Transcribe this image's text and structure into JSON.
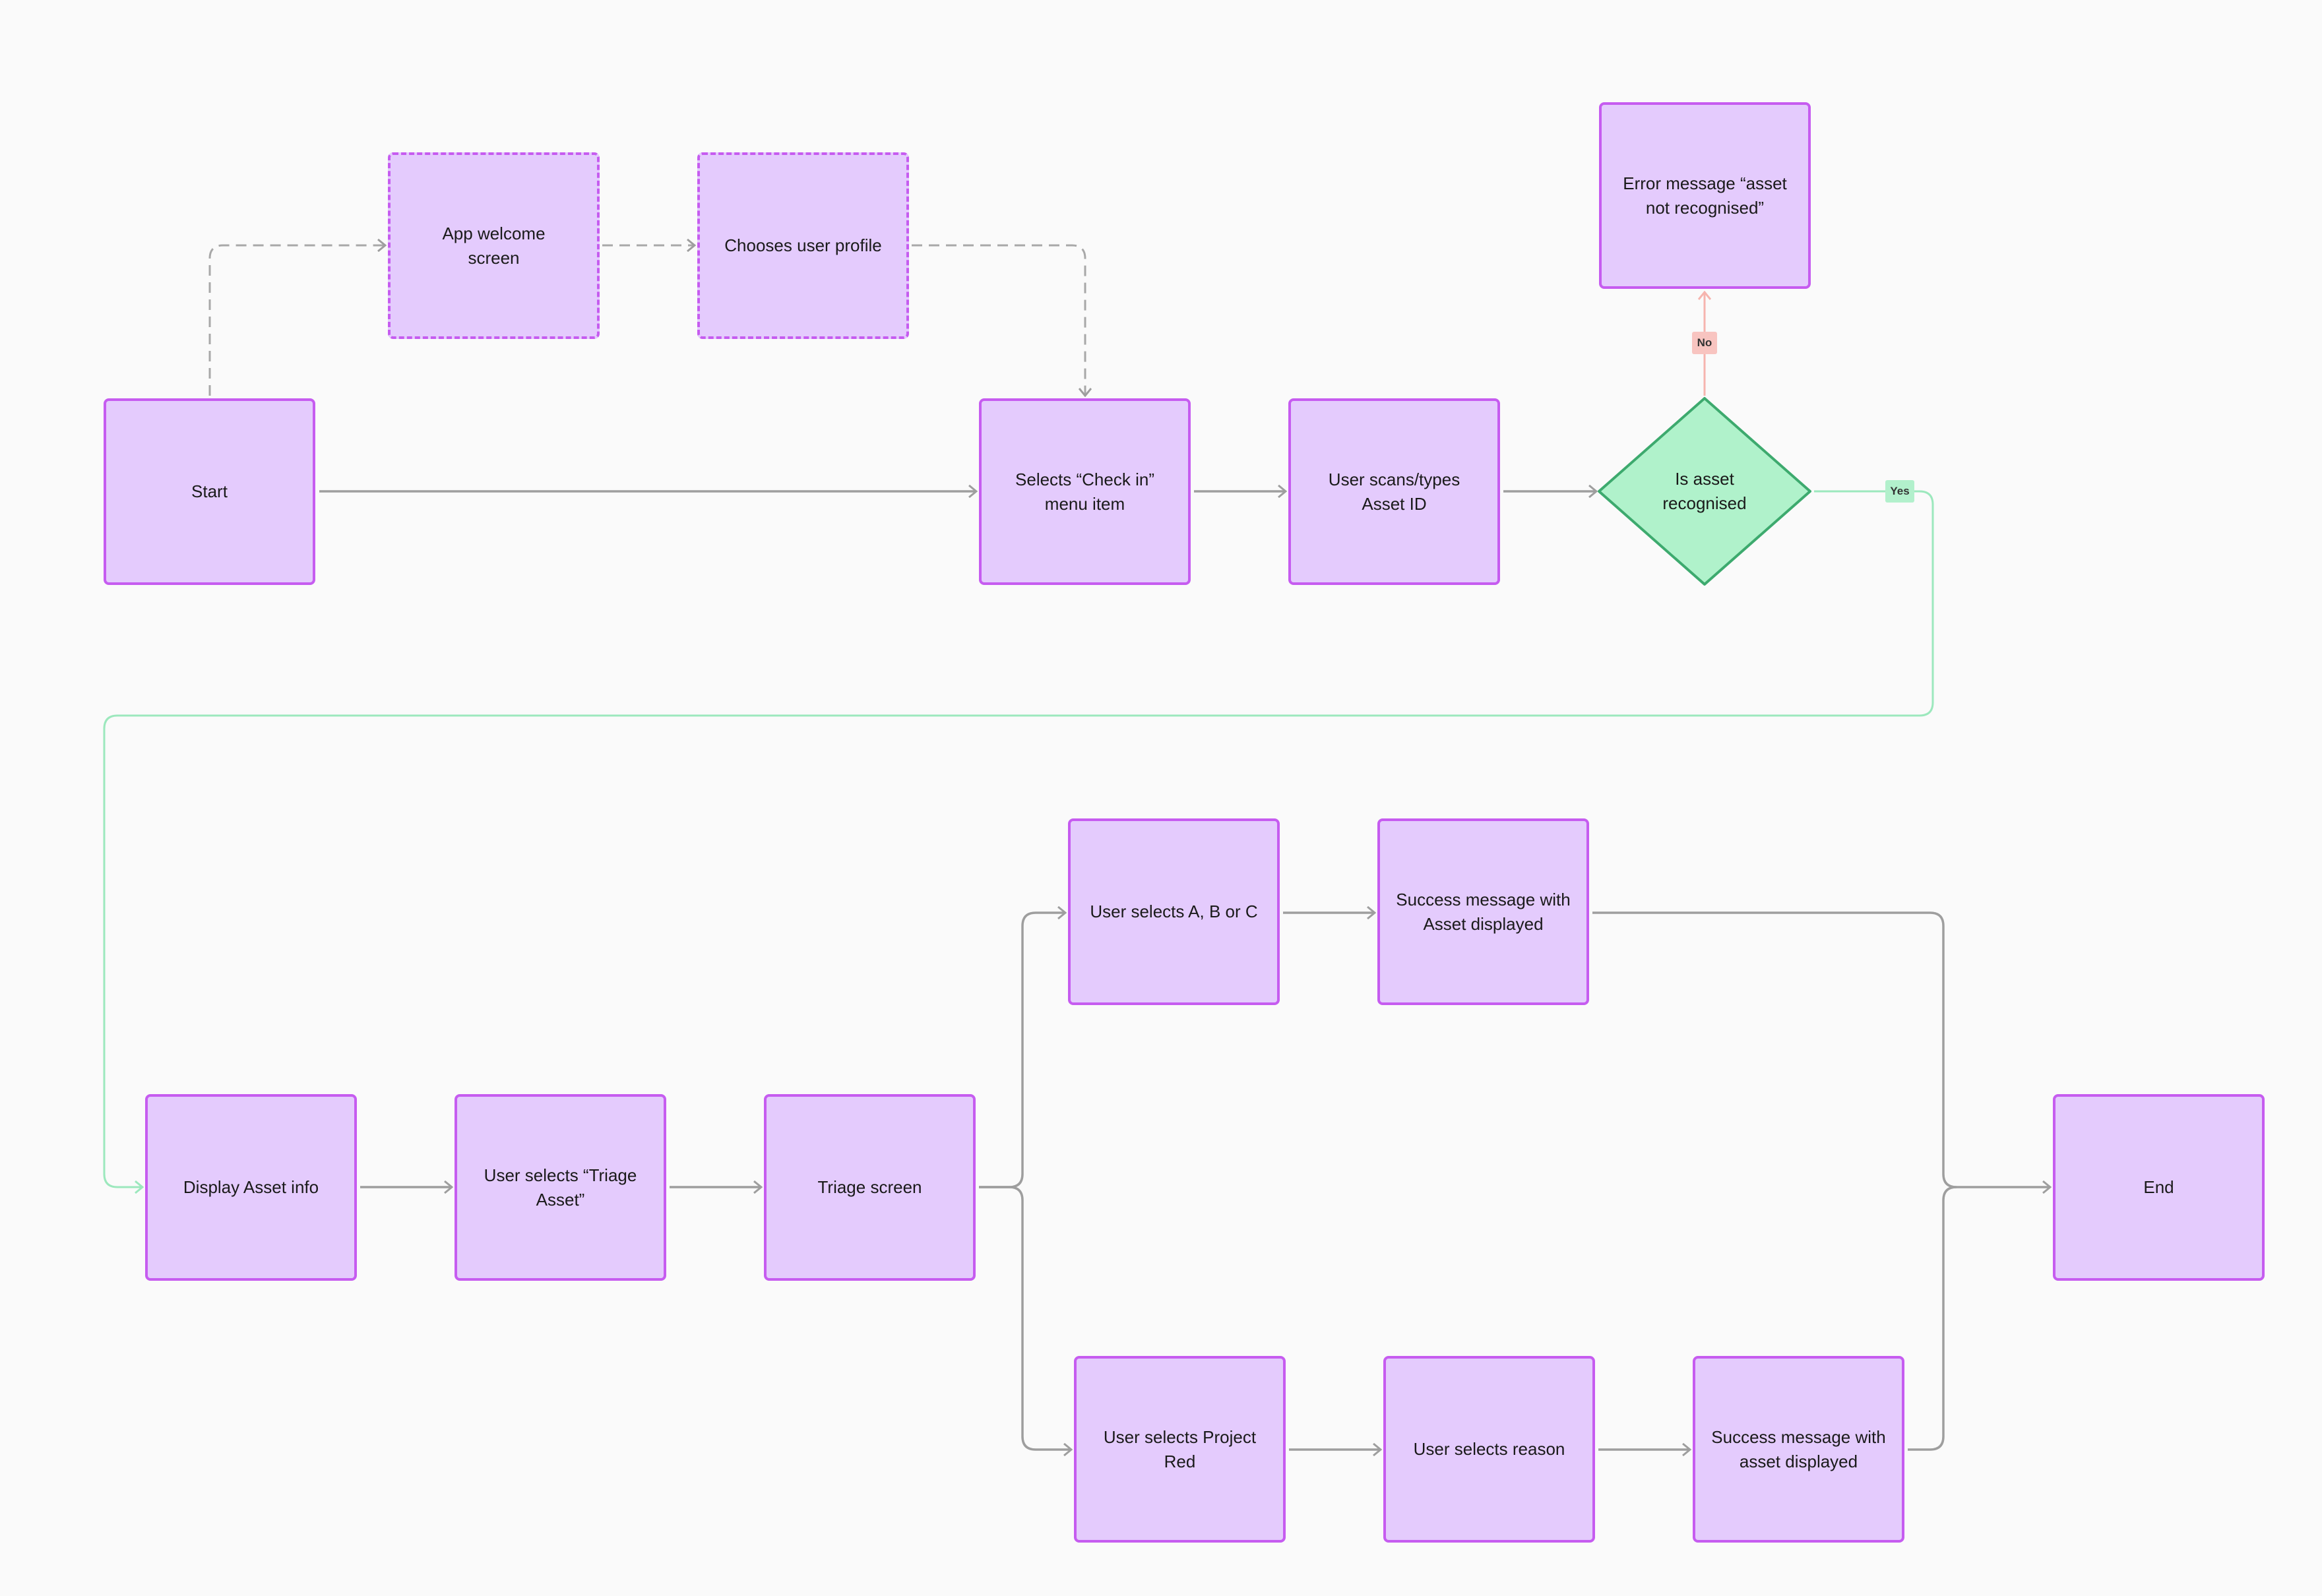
{
  "diagram": {
    "type": "flowchart",
    "nodes": {
      "start": "Start",
      "welcome": "App welcome screen",
      "profile": "Chooses user profile",
      "checkin": "Selects “Check in” menu item",
      "scan": "User scans/types Asset ID",
      "decision": "Is asset recognised",
      "error": "Error message “asset not recognised”",
      "display": "Display Asset info",
      "triage_asset": "User selects “Triage Asset”",
      "triage_screen": "Triage screen",
      "abc": "User selects A, B or C",
      "success1": "Success message with Asset displayed",
      "project_red": "User selects Project Red",
      "reason": "User selects reason",
      "success2": "Success message with asset displayed",
      "end": "End"
    },
    "edge_labels": {
      "no": "No",
      "yes": "Yes"
    },
    "edges": [
      {
        "from": "start",
        "to": "welcome",
        "style": "dashed"
      },
      {
        "from": "welcome",
        "to": "profile",
        "style": "dashed"
      },
      {
        "from": "profile",
        "to": "checkin",
        "style": "dashed"
      },
      {
        "from": "start",
        "to": "checkin",
        "style": "solid"
      },
      {
        "from": "checkin",
        "to": "scan",
        "style": "solid"
      },
      {
        "from": "scan",
        "to": "decision",
        "style": "solid"
      },
      {
        "from": "decision",
        "to": "error",
        "label": "No"
      },
      {
        "from": "decision",
        "to": "display",
        "label": "Yes"
      },
      {
        "from": "display",
        "to": "triage_asset"
      },
      {
        "from": "triage_asset",
        "to": "triage_screen"
      },
      {
        "from": "triage_screen",
        "to": "abc"
      },
      {
        "from": "triage_screen",
        "to": "project_red"
      },
      {
        "from": "abc",
        "to": "success1"
      },
      {
        "from": "project_red",
        "to": "reason"
      },
      {
        "from": "reason",
        "to": "success2"
      },
      {
        "from": "success1",
        "to": "end"
      },
      {
        "from": "success2",
        "to": "end"
      }
    ],
    "colors": {
      "node_fill": "#e4cbfd",
      "node_stroke": "#c65cf0",
      "decision_fill": "#b0f2cb",
      "decision_stroke": "#3daa6e",
      "edge": "#9e9e9e",
      "yes_edge": "#9ce8bd",
      "no_edge": "#f6b4ae",
      "background": "#fafafa"
    }
  }
}
